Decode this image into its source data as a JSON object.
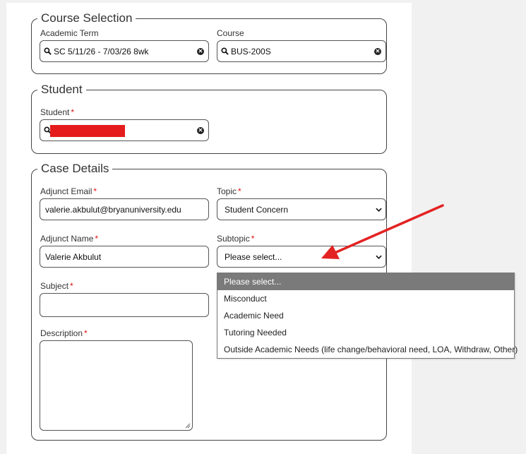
{
  "course_selection": {
    "legend": "Course Selection",
    "term_label": "Academic Term",
    "term_value": "SC 5/11/26 - 7/03/26 8wk",
    "course_label": "Course",
    "course_value": "BUS-200S"
  },
  "student_section": {
    "legend": "Student",
    "student_label": "Student",
    "required_mark": "*"
  },
  "case_details": {
    "legend": "Case Details",
    "adjunct_email_label": "Adjunct Email",
    "adjunct_email_value": "valerie.akbulut@bryanuniversity.edu",
    "topic_label": "Topic",
    "topic_value": "Student Concern",
    "adjunct_name_label": "Adjunct Name",
    "adjunct_name_value": "Valerie Akbulut",
    "subtopic_label": "Subtopic",
    "subtopic_value": "Please select...",
    "subject_label": "Subject",
    "description_label": "Description",
    "required_mark": "*"
  },
  "subtopic_options": [
    "Please select...",
    "Misconduct",
    "Academic Need",
    "Tutoring Needed",
    "Outside Academic Needs (life change/behavioral need, LOA, Withdraw, Other)"
  ],
  "colors": {
    "required": "#dd1111",
    "annotation_arrow": "#e32222",
    "redaction": "#e41c1c",
    "selected_option_bg": "#7a7a7a"
  },
  "icons": {
    "search": "search-icon",
    "clear": "clear-icon",
    "chevron": "chevron-down-icon",
    "resize": "resize-grip-icon"
  }
}
